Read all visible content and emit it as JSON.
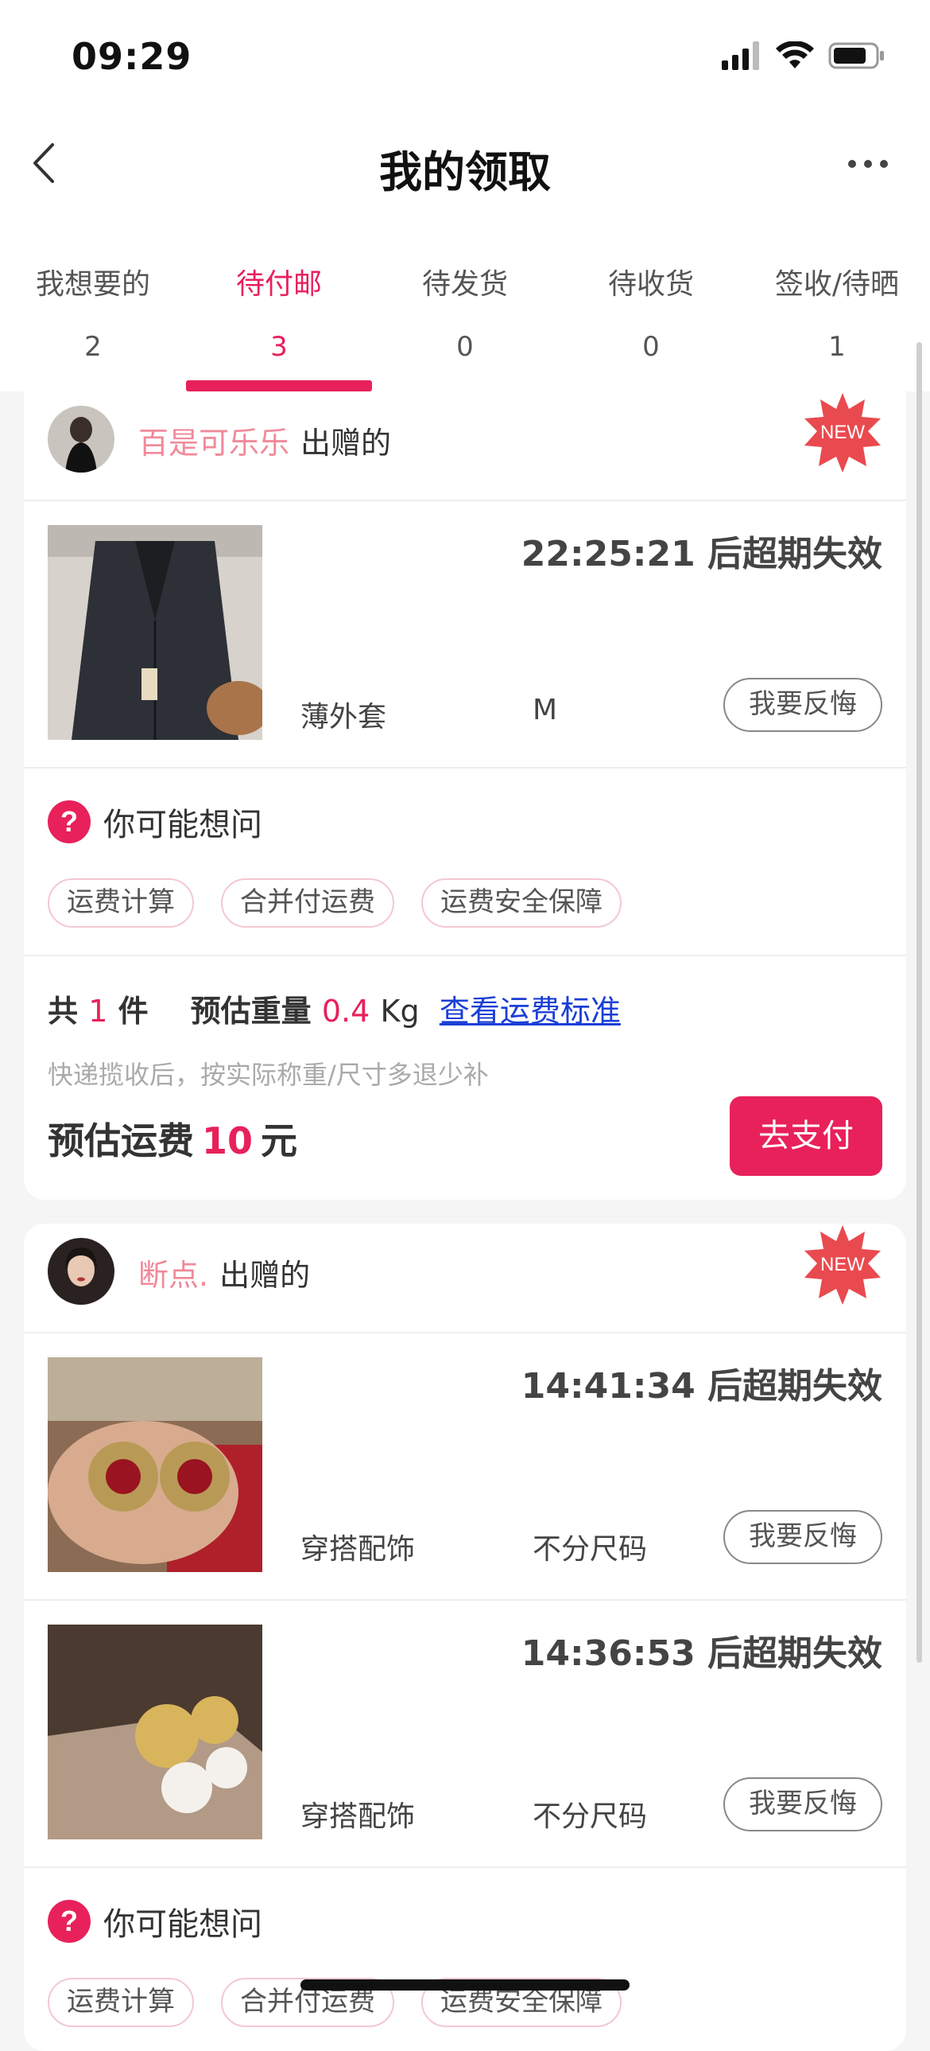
{
  "status_bar": {
    "time": "09:29"
  },
  "header": {
    "title": "我的领取"
  },
  "tabs": [
    {
      "label": "我想要的",
      "count": "2"
    },
    {
      "label": "待付邮",
      "count": "3"
    },
    {
      "label": "待发货",
      "count": "0"
    },
    {
      "label": "待收货",
      "count": "0"
    },
    {
      "label": "签收/待晒",
      "count": "1"
    }
  ],
  "active_tab": "待付邮",
  "orders": [
    {
      "donor": "百是可乐乐",
      "donor_suffix": "出赠的",
      "badge": "NEW",
      "items": [
        {
          "expire": "22:25:21 后超期失效",
          "category": "薄外套",
          "size": "M",
          "regret": "我要反悔"
        }
      ],
      "faq": {
        "title": "你可能想问",
        "chips": [
          "运费计算",
          "合并付运费",
          "运费安全保障"
        ]
      },
      "summary": {
        "count_prefix": "共",
        "count": "1",
        "count_suffix": "件",
        "weight_label": "预估重量",
        "weight": "0.4",
        "weight_unit": "Kg",
        "link": "查看运费标准",
        "note": "快递揽收后，按实际称重/尺寸多退少补",
        "fee_label": "预估运费",
        "fee": "10",
        "fee_unit": "元",
        "pay": "去支付"
      }
    },
    {
      "donor": "断点.",
      "donor_suffix": "出赠的",
      "badge": "NEW",
      "items": [
        {
          "expire": "14:41:34 后超期失效",
          "category": "穿搭配饰",
          "size": "不分尺码",
          "regret": "我要反悔"
        },
        {
          "expire": "14:36:53 后超期失效",
          "category": "穿搭配饰",
          "size": "不分尺码",
          "regret": "我要反悔"
        }
      ],
      "faq": {
        "title": "你可能想问",
        "chips": [
          "运费计算",
          "合并付运费",
          "运费安全保障"
        ]
      }
    }
  ],
  "colors": {
    "accent": "#e8215b",
    "donor_name": "#f08a9a",
    "link": "#1b3fd6"
  }
}
